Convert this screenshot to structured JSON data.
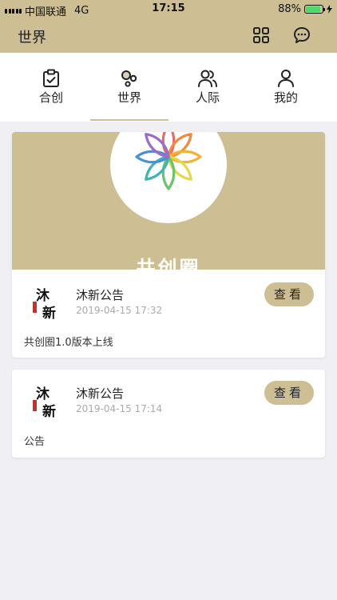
{
  "status": {
    "carrier": "中国联通",
    "network": "4G",
    "time": "17:15",
    "battery": "88%",
    "battery_level": 0.88,
    "battery_color": "#4cd964"
  },
  "header": {
    "title": "世界"
  },
  "tabs": [
    {
      "label": "合创",
      "icon": "clipboard-check-icon"
    },
    {
      "label": "世界",
      "icon": "bubbles-icon"
    },
    {
      "label": "人际",
      "icon": "people-icon"
    },
    {
      "label": "我的",
      "icon": "person-icon"
    }
  ],
  "active_tab": "世界",
  "theme": {
    "accent": "#cdbf93",
    "background": "#efeff4"
  },
  "banner": {
    "text": "共创圈"
  },
  "posts": [
    {
      "logo_text": "沐新",
      "title": "沐新公告",
      "time": "2019-04-15 17:32",
      "body": "共创圈1.0版本上线",
      "button": "查看"
    },
    {
      "logo_text": "沐新",
      "title": "沐新公告",
      "time": "2019-04-15 17:14",
      "body": "公告",
      "button": "查看"
    }
  ]
}
